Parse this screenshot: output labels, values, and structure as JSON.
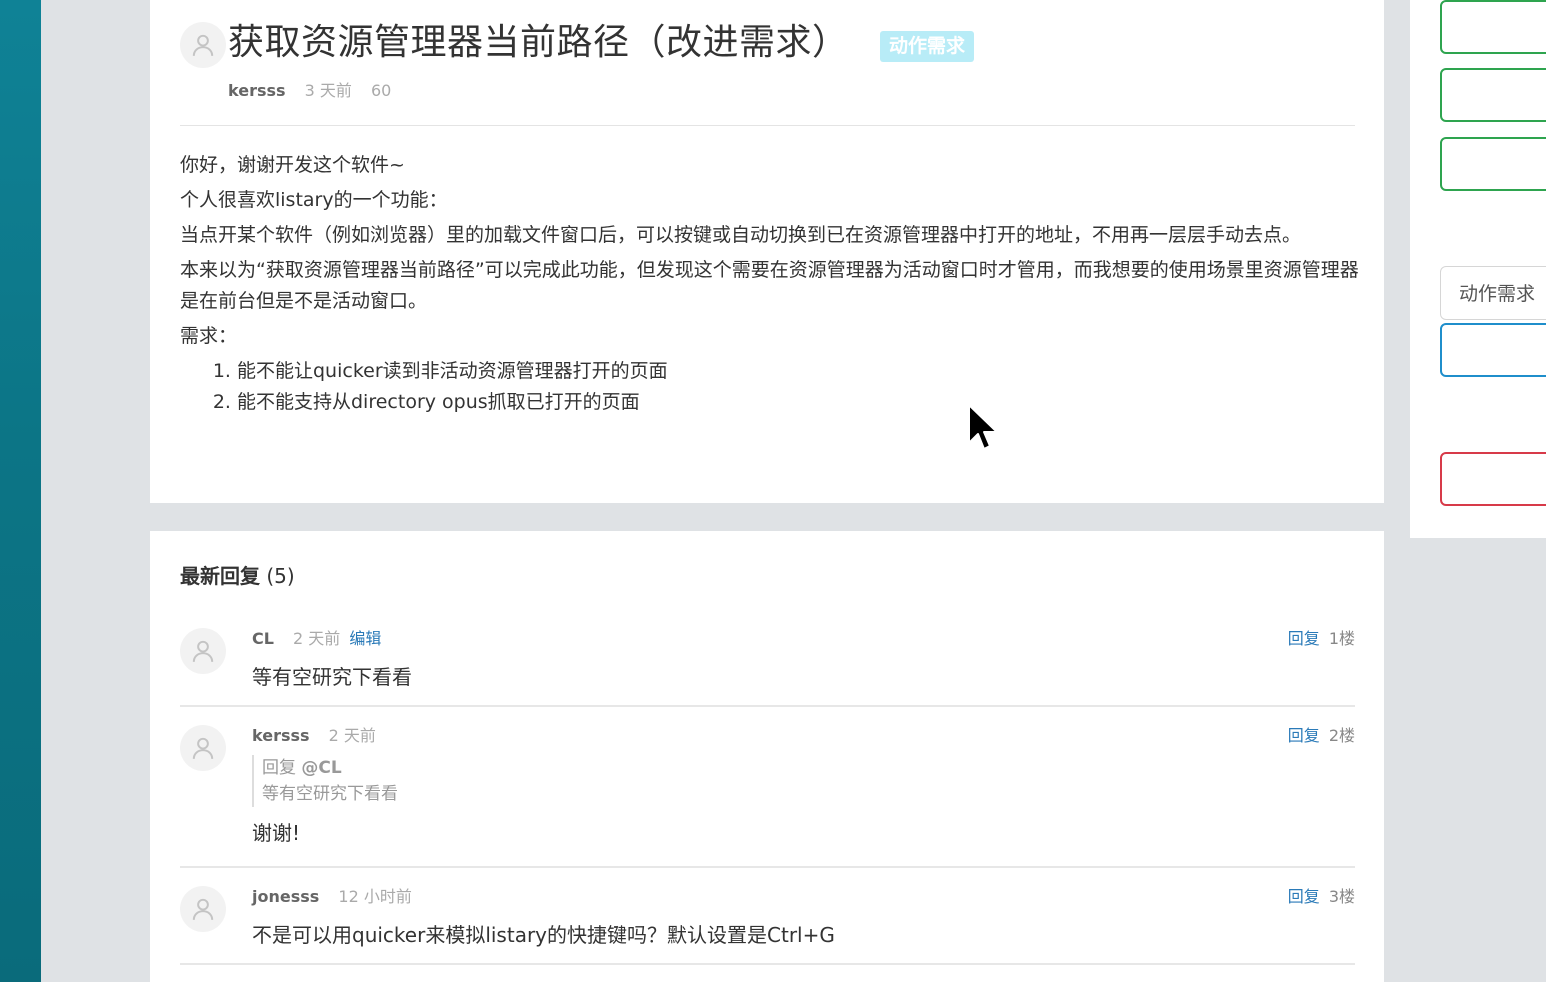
{
  "topic": {
    "title": "获取资源管理器当前路径（改进需求）",
    "tag": "动作需求",
    "author": "kersss",
    "time": "3 天前",
    "views": "60",
    "paragraphs": [
      "你好，谢谢开发这个软件~",
      "个人很喜欢listary的一个功能：",
      "当点开某个软件（例如浏览器）里的加载文件窗口后，可以按键或自动切换到已在资源管理器中打开的地址，不用再一层层手动去点。",
      "本来以为“获取资源管理器当前路径”可以完成此功能，但发现这个需要在资源管理器为活动窗口时才管用，而我想要的使用场景里资源管理器是在前台但是不是活动窗口。",
      "需求："
    ],
    "list": [
      "能不能让quicker读到非活动资源管理器打开的页面",
      "能不能支持从directory opus抓取已打开的页面"
    ]
  },
  "replies_section": {
    "title": "最新回复",
    "count": "(5)"
  },
  "replies": [
    {
      "name": "CL",
      "time": "2 天前",
      "edit": "编辑",
      "reply_label": "回复",
      "floor": "1楼",
      "body": "等有空研究下看看"
    },
    {
      "name": "kersss",
      "time": "2 天前",
      "reply_label": "回复",
      "floor": "2楼",
      "quote_prefix": "回复",
      "quote_at": "@CL",
      "quote_text": "等有空研究下看看",
      "body": "谢谢!"
    },
    {
      "name": "jonesss",
      "time": "12 小时前",
      "reply_label": "回复",
      "floor": "3楼",
      "body": "不是可以用quicker来模拟listary的快捷键吗？默认设置是Ctrl+G"
    }
  ],
  "sidebar": {
    "category_button": "动作需求"
  },
  "colors": {
    "tag_bg": "#b8ecf7",
    "link": "#2a7ab8",
    "green": "#2ea44f",
    "blue": "#1f8ecb",
    "red": "#d73a49"
  },
  "icons": [
    "user-avatar-icon",
    "mouse-cursor-icon"
  ]
}
